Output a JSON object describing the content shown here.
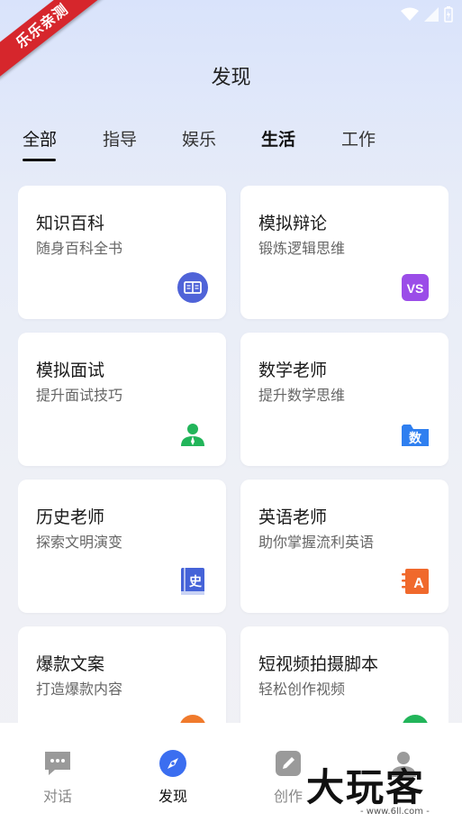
{
  "ribbon": {
    "text": "乐乐亲测"
  },
  "header": {
    "title": "发现"
  },
  "tabs": [
    {
      "label": "全部"
    },
    {
      "label": "指导"
    },
    {
      "label": "娱乐"
    },
    {
      "label": "生活"
    },
    {
      "label": "工作"
    }
  ],
  "cards": [
    {
      "title": "知识百科",
      "subtitle": "随身百科全书",
      "icon": "book-icon",
      "icon_color": "#4f63d8"
    },
    {
      "title": "模拟辩论",
      "subtitle": "锻炼逻辑思维",
      "icon": "vs-icon",
      "icon_text": "VS",
      "icon_color": "#9b4de8"
    },
    {
      "title": "模拟面试",
      "subtitle": "提升面试技巧",
      "icon": "person-icon",
      "icon_color": "#22b55a"
    },
    {
      "title": "数学老师",
      "subtitle": "提升数学思维",
      "icon": "math-folder-icon",
      "icon_text": "数",
      "icon_color": "#2f7ff0"
    },
    {
      "title": "历史老师",
      "subtitle": "探索文明演变",
      "icon": "history-book-icon",
      "icon_text": "史",
      "icon_color": "#4563d8"
    },
    {
      "title": "英语老师",
      "subtitle": "助你掌握流利英语",
      "icon": "english-book-icon",
      "icon_text": "A",
      "icon_color": "#f0692c"
    },
    {
      "title": "爆款文案",
      "subtitle": "打造爆款内容",
      "icon": "orange-icon",
      "icon_color": "#f07a2c"
    },
    {
      "title": "短视频拍摄脚本",
      "subtitle": "轻松创作视频",
      "icon": "green-icon",
      "icon_color": "#22b55a"
    }
  ],
  "nav": {
    "chat": "对话",
    "discover": "发现",
    "create": "创作",
    "profile": ""
  },
  "watermark": {
    "text": "大玩客",
    "sub": "- www.6ll.com -"
  }
}
